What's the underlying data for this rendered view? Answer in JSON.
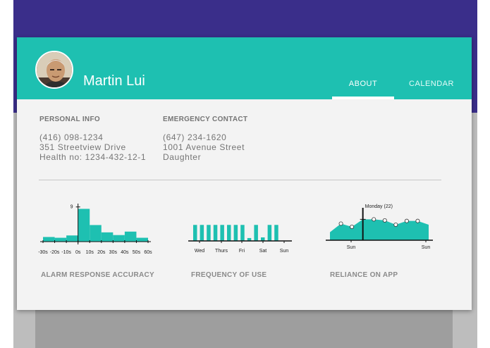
{
  "profile": {
    "name": "Martin Lui",
    "avatar_icon": "person-photo"
  },
  "tabs": [
    {
      "label": "ABOUT",
      "active": true
    },
    {
      "label": "CALENDAR",
      "active": false
    }
  ],
  "personal_info": {
    "heading": "PERSONAL INFO",
    "lines": [
      "(416) 098-1234",
      "351 Streetview Drive",
      "Health no: 1234-432-12-1"
    ]
  },
  "emergency_contact": {
    "heading": "EMERGENCY CONTACT",
    "lines": [
      "(647) 234-1620",
      "1001 Avenue Street",
      "Daughter"
    ]
  },
  "colors": {
    "accent": "#1ec0b1",
    "top_bar": "#3a2e8a"
  },
  "chart_data": [
    {
      "type": "bar",
      "title": "ALARM RESPONSE ACCURACY",
      "categories": [
        "-30s",
        "-20s",
        "-10s",
        "0s",
        "10s",
        "20s",
        "30s",
        "40s",
        "50s",
        "60s"
      ],
      "values": [
        1.2,
        1,
        1.6,
        8.5,
        4.3,
        2.4,
        1.7,
        2.6,
        1
      ],
      "ytick": "9",
      "ylim": [
        0,
        9.5
      ]
    },
    {
      "type": "bar",
      "title": "FREQUENCY  OF USE",
      "x_labels": [
        "Wed",
        "Thurs",
        "Fri",
        "Sat",
        "Sun"
      ],
      "values": [
        1,
        1,
        1,
        1,
        1,
        1,
        1,
        1,
        0.18,
        1,
        0.22,
        1,
        1
      ],
      "ylim": [
        0,
        1.1
      ]
    },
    {
      "type": "area",
      "title": "RELIANCE ON APP",
      "x_labels": [
        "Sun",
        "Sun"
      ],
      "values": [
        0.3,
        0.62,
        0.5,
        0.78,
        0.78,
        0.74,
        0.58,
        0.72,
        0.72,
        0.58
      ],
      "ylim": [
        0,
        1
      ],
      "tooltip": "Monday (22)"
    }
  ]
}
